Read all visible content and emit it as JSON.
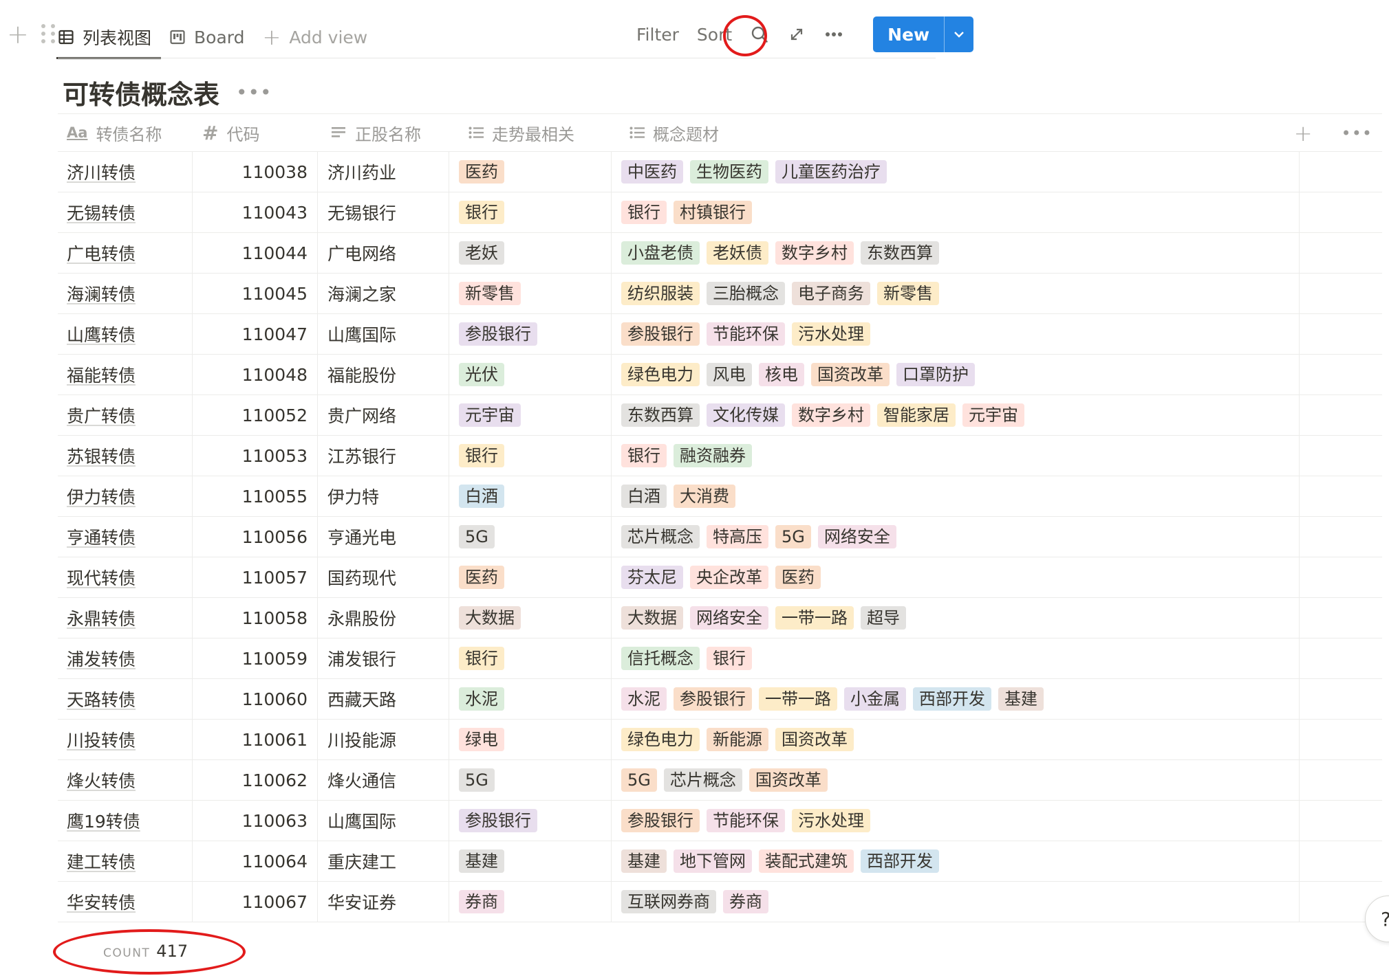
{
  "toolbar": {
    "tabs": [
      {
        "label": "列表视图",
        "icon": "table-icon",
        "active": true
      },
      {
        "label": "Board",
        "icon": "board-icon",
        "active": false
      }
    ],
    "add_view_label": "Add view",
    "filter_label": "Filter",
    "sort_label": "Sort",
    "new_label": "New",
    "accent_color": "#2383e2",
    "annotation_color": "#e21b1b"
  },
  "page": {
    "title": "可转债概念表"
  },
  "table": {
    "columns": [
      {
        "label": "转债名称",
        "icon": "Aa"
      },
      {
        "label": "代码",
        "icon": "#"
      },
      {
        "label": "正股名称",
        "icon": "lines"
      },
      {
        "label": "走势最相关",
        "icon": "list"
      },
      {
        "label": "概念题材",
        "icon": "list"
      }
    ],
    "tag_colors": {
      "orange": "#fadec9",
      "yellow": "#fdecc8",
      "gray": "#e3e2e0",
      "brown": "#eee0da",
      "purple": "#e8deee",
      "pink": "#f5e0e9",
      "red": "#ffe2dd",
      "green": "#dbeddb",
      "blue": "#d3e5ef"
    },
    "rows": [
      {
        "name": "济川转债",
        "code": "110038",
        "stock": "济川药业",
        "trend": {
          "label": "医药",
          "color": "orange"
        },
        "concepts": [
          {
            "label": "中医药",
            "color": "purple"
          },
          {
            "label": "生物医药",
            "color": "green"
          },
          {
            "label": "儿童医药治疗",
            "color": "purple"
          }
        ]
      },
      {
        "name": "无锡转债",
        "code": "110043",
        "stock": "无锡银行",
        "trend": {
          "label": "银行",
          "color": "yellow"
        },
        "concepts": [
          {
            "label": "银行",
            "color": "red"
          },
          {
            "label": "村镇银行",
            "color": "orange"
          }
        ]
      },
      {
        "name": "广电转债",
        "code": "110044",
        "stock": "广电网络",
        "trend": {
          "label": "老妖",
          "color": "gray"
        },
        "concepts": [
          {
            "label": "小盘老债",
            "color": "green"
          },
          {
            "label": "老妖债",
            "color": "yellow"
          },
          {
            "label": "数字乡村",
            "color": "red"
          },
          {
            "label": "东数西算",
            "color": "gray"
          }
        ]
      },
      {
        "name": "海澜转债",
        "code": "110045",
        "stock": "海澜之家",
        "trend": {
          "label": "新零售",
          "color": "red"
        },
        "concepts": [
          {
            "label": "纺织服装",
            "color": "yellow"
          },
          {
            "label": "三胎概念",
            "color": "gray"
          },
          {
            "label": "电子商务",
            "color": "brown"
          },
          {
            "label": "新零售",
            "color": "yellow"
          }
        ]
      },
      {
        "name": "山鹰转债",
        "code": "110047",
        "stock": "山鹰国际",
        "trend": {
          "label": "参股银行",
          "color": "purple"
        },
        "concepts": [
          {
            "label": "参股银行",
            "color": "orange"
          },
          {
            "label": "节能环保",
            "color": "pink"
          },
          {
            "label": "污水处理",
            "color": "yellow"
          }
        ]
      },
      {
        "name": "福能转债",
        "code": "110048",
        "stock": "福能股份",
        "trend": {
          "label": "光伏",
          "color": "green"
        },
        "concepts": [
          {
            "label": "绿色电力",
            "color": "yellow"
          },
          {
            "label": "风电",
            "color": "gray"
          },
          {
            "label": "核电",
            "color": "pink"
          },
          {
            "label": "国资改革",
            "color": "orange"
          },
          {
            "label": "口罩防护",
            "color": "purple"
          }
        ]
      },
      {
        "name": "贵广转债",
        "code": "110052",
        "stock": "贵广网络",
        "trend": {
          "label": "元宇宙",
          "color": "purple"
        },
        "concepts": [
          {
            "label": "东数西算",
            "color": "gray"
          },
          {
            "label": "文化传媒",
            "color": "purple"
          },
          {
            "label": "数字乡村",
            "color": "red"
          },
          {
            "label": "智能家居",
            "color": "yellow"
          },
          {
            "label": "元宇宙",
            "color": "red"
          }
        ]
      },
      {
        "name": "苏银转债",
        "code": "110053",
        "stock": "江苏银行",
        "trend": {
          "label": "银行",
          "color": "yellow"
        },
        "concepts": [
          {
            "label": "银行",
            "color": "red"
          },
          {
            "label": "融资融券",
            "color": "green"
          }
        ]
      },
      {
        "name": "伊力转债",
        "code": "110055",
        "stock": "伊力特",
        "trend": {
          "label": "白酒",
          "color": "blue"
        },
        "concepts": [
          {
            "label": "白酒",
            "color": "gray"
          },
          {
            "label": "大消费",
            "color": "orange"
          }
        ]
      },
      {
        "name": "亨通转债",
        "code": "110056",
        "stock": "亨通光电",
        "trend": {
          "label": "5G",
          "color": "gray"
        },
        "concepts": [
          {
            "label": "芯片概念",
            "color": "gray"
          },
          {
            "label": "特高压",
            "color": "red"
          },
          {
            "label": "5G",
            "color": "orange"
          },
          {
            "label": "网络安全",
            "color": "pink"
          }
        ]
      },
      {
        "name": "现代转债",
        "code": "110057",
        "stock": "国药现代",
        "trend": {
          "label": "医药",
          "color": "orange"
        },
        "concepts": [
          {
            "label": "芬太尼",
            "color": "purple"
          },
          {
            "label": "央企改革",
            "color": "red"
          },
          {
            "label": "医药",
            "color": "orange"
          }
        ]
      },
      {
        "name": "永鼎转债",
        "code": "110058",
        "stock": "永鼎股份",
        "trend": {
          "label": "大数据",
          "color": "brown"
        },
        "concepts": [
          {
            "label": "大数据",
            "color": "brown"
          },
          {
            "label": "网络安全",
            "color": "pink"
          },
          {
            "label": "一带一路",
            "color": "yellow"
          },
          {
            "label": "超导",
            "color": "gray"
          }
        ]
      },
      {
        "name": "浦发转债",
        "code": "110059",
        "stock": "浦发银行",
        "trend": {
          "label": "银行",
          "color": "yellow"
        },
        "concepts": [
          {
            "label": "信托概念",
            "color": "green"
          },
          {
            "label": "银行",
            "color": "red"
          }
        ]
      },
      {
        "name": "天路转债",
        "code": "110060",
        "stock": "西藏天路",
        "trend": {
          "label": "水泥",
          "color": "green"
        },
        "concepts": [
          {
            "label": "水泥",
            "color": "pink"
          },
          {
            "label": "参股银行",
            "color": "orange"
          },
          {
            "label": "一带一路",
            "color": "yellow"
          },
          {
            "label": "小金属",
            "color": "purple"
          },
          {
            "label": "西部开发",
            "color": "blue"
          },
          {
            "label": "基建",
            "color": "brown"
          }
        ]
      },
      {
        "name": "川投转债",
        "code": "110061",
        "stock": "川投能源",
        "trend": {
          "label": "绿电",
          "color": "red"
        },
        "concepts": [
          {
            "label": "绿色电力",
            "color": "yellow"
          },
          {
            "label": "新能源",
            "color": "orange"
          },
          {
            "label": "国资改革",
            "color": "yellow"
          }
        ]
      },
      {
        "name": "烽火转债",
        "code": "110062",
        "stock": "烽火通信",
        "trend": {
          "label": "5G",
          "color": "gray"
        },
        "concepts": [
          {
            "label": "5G",
            "color": "orange"
          },
          {
            "label": "芯片概念",
            "color": "gray"
          },
          {
            "label": "国资改革",
            "color": "orange"
          }
        ]
      },
      {
        "name": "鹰19转债",
        "code": "110063",
        "stock": "山鹰国际",
        "trend": {
          "label": "参股银行",
          "color": "purple"
        },
        "concepts": [
          {
            "label": "参股银行",
            "color": "orange"
          },
          {
            "label": "节能环保",
            "color": "pink"
          },
          {
            "label": "污水处理",
            "color": "yellow"
          }
        ]
      },
      {
        "name": "建工转债",
        "code": "110064",
        "stock": "重庆建工",
        "trend": {
          "label": "基建",
          "color": "gray"
        },
        "concepts": [
          {
            "label": "基建",
            "color": "brown"
          },
          {
            "label": "地下管网",
            "color": "pink"
          },
          {
            "label": "装配式建筑",
            "color": "red"
          },
          {
            "label": "西部开发",
            "color": "blue"
          }
        ]
      },
      {
        "name": "华安转债",
        "code": "110067",
        "stock": "华安证券",
        "trend": {
          "label": "券商",
          "color": "pink"
        },
        "concepts": [
          {
            "label": "互联网券商",
            "color": "gray"
          },
          {
            "label": "券商",
            "color": "pink"
          }
        ]
      }
    ]
  },
  "footer": {
    "count_label": "COUNT",
    "count_value": "417"
  },
  "help_label": "?"
}
